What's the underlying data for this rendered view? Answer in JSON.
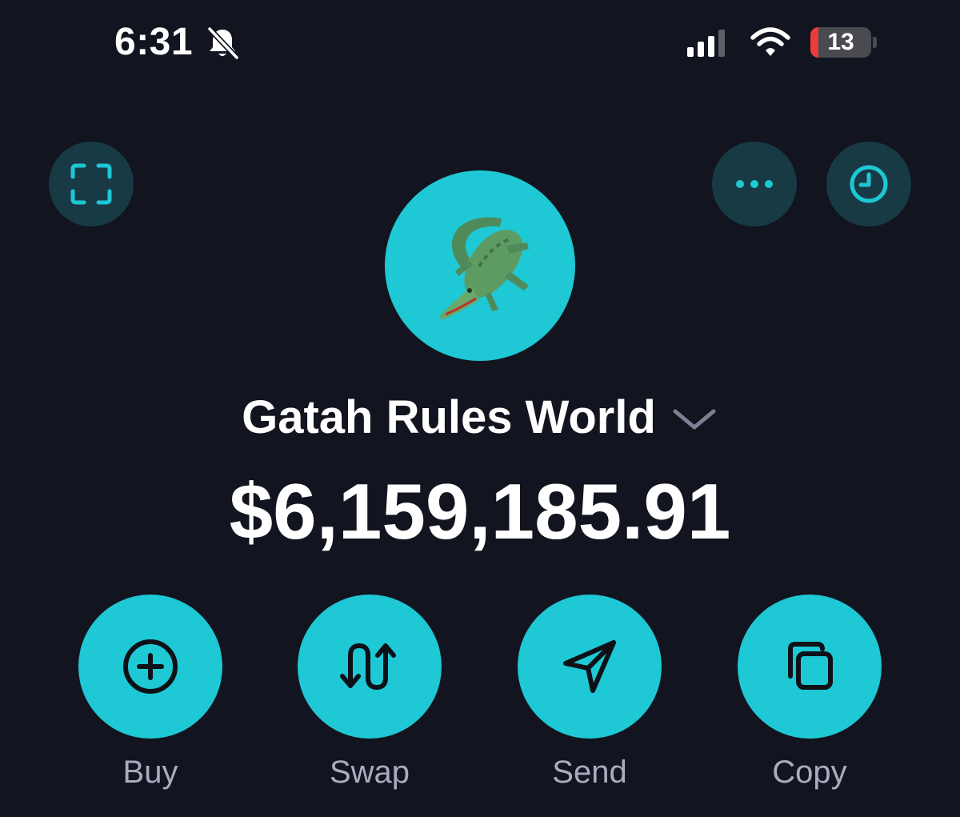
{
  "status_bar": {
    "time": "6:31",
    "battery_level": "13",
    "icons": [
      "bell-slash-icon",
      "cellular-signal-icon",
      "wifi-icon",
      "battery-icon"
    ]
  },
  "header": {
    "left_button_icon": "scan-qr-icon",
    "right_buttons": [
      "more-icon",
      "history-clock-icon"
    ]
  },
  "wallet": {
    "avatar_emoji": "🐊",
    "name": "Gatah Rules World",
    "balance": "$6,159,185.91"
  },
  "actions": [
    {
      "label": "Buy",
      "icon": "plus-circle-icon"
    },
    {
      "label": "Swap",
      "icon": "swap-arrows-icon"
    },
    {
      "label": "Send",
      "icon": "send-arrow-icon"
    },
    {
      "label": "Copy",
      "icon": "copy-icon"
    }
  ],
  "colors": {
    "background": "#12141f",
    "accent": "#1ec8d4",
    "button_dark": "#183a45",
    "label_gray": "#a7adc1",
    "battery_low": "#eb3b3a"
  }
}
